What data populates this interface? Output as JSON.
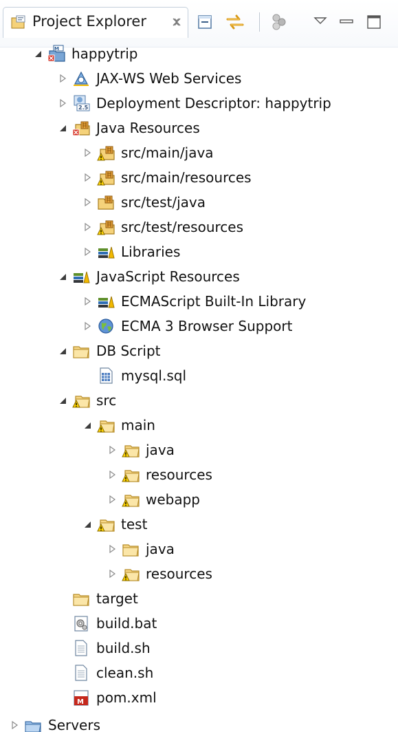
{
  "view": {
    "title": "Project Explorer"
  },
  "toolbar": {
    "items": [
      "collapse-all-icon",
      "link-with-editor-icon",
      "filters-icon",
      "view-menu-icon",
      "minimize-icon",
      "maximize-icon"
    ]
  },
  "tree": [
    {
      "label": "happytrip",
      "depth": 0,
      "state": "expanded",
      "icon": "maven-web-project-icon"
    },
    {
      "label": "JAX-WS Web Services",
      "depth": 1,
      "state": "collapsed",
      "icon": "web-services-icon"
    },
    {
      "label": "Deployment Descriptor: happytrip",
      "depth": 1,
      "state": "collapsed",
      "icon": "deployment-descriptor-icon"
    },
    {
      "label": "Java Resources",
      "depth": 1,
      "state": "expanded",
      "icon": "java-resources-error-icon"
    },
    {
      "label": "src/main/java",
      "depth": 2,
      "state": "collapsed",
      "icon": "source-folder-warning-icon"
    },
    {
      "label": "src/main/resources",
      "depth": 2,
      "state": "collapsed",
      "icon": "source-folder-warning-icon"
    },
    {
      "label": "src/test/java",
      "depth": 2,
      "state": "collapsed",
      "icon": "source-folder-icon"
    },
    {
      "label": "src/test/resources",
      "depth": 2,
      "state": "collapsed",
      "icon": "source-folder-warning-icon"
    },
    {
      "label": "Libraries",
      "depth": 2,
      "state": "collapsed",
      "icon": "library-icon"
    },
    {
      "label": "JavaScript Resources",
      "depth": 1,
      "state": "expanded",
      "icon": "library-icon"
    },
    {
      "label": "ECMAScript Built-In Library",
      "depth": 2,
      "state": "collapsed",
      "icon": "library-icon"
    },
    {
      "label": "ECMA 3 Browser Support",
      "depth": 2,
      "state": "collapsed",
      "icon": "globe-icon"
    },
    {
      "label": "DB Script",
      "depth": 1,
      "state": "expanded",
      "icon": "folder-icon"
    },
    {
      "label": "mysql.sql",
      "depth": 2,
      "state": "leaf",
      "icon": "sql-file-icon"
    },
    {
      "label": "src",
      "depth": 1,
      "state": "expanded",
      "icon": "folder-warning-icon"
    },
    {
      "label": "main",
      "depth": 2,
      "state": "expanded",
      "icon": "folder-warning-icon"
    },
    {
      "label": "java",
      "depth": 3,
      "state": "collapsed",
      "icon": "folder-warning-icon"
    },
    {
      "label": "resources",
      "depth": 3,
      "state": "collapsed",
      "icon": "folder-warning-icon"
    },
    {
      "label": "webapp",
      "depth": 3,
      "state": "collapsed",
      "icon": "folder-warning-icon"
    },
    {
      "label": "test",
      "depth": 2,
      "state": "expanded",
      "icon": "folder-warning-icon"
    },
    {
      "label": "java",
      "depth": 3,
      "state": "collapsed",
      "icon": "folder-icon"
    },
    {
      "label": "resources",
      "depth": 3,
      "state": "collapsed",
      "icon": "folder-warning-icon"
    },
    {
      "label": "target",
      "depth": 1,
      "state": "leaf",
      "icon": "folder-icon"
    },
    {
      "label": "build.bat",
      "depth": 1,
      "state": "leaf",
      "icon": "batch-file-icon"
    },
    {
      "label": "build.sh",
      "depth": 1,
      "state": "leaf",
      "icon": "text-file-icon"
    },
    {
      "label": "clean.sh",
      "depth": 1,
      "state": "leaf",
      "icon": "text-file-icon"
    },
    {
      "label": "pom.xml",
      "depth": 1,
      "state": "leaf",
      "icon": "maven-pom-icon"
    },
    {
      "label": "Servers",
      "depth": 0,
      "state": "collapsed",
      "icon": "servers-folder-icon"
    }
  ]
}
